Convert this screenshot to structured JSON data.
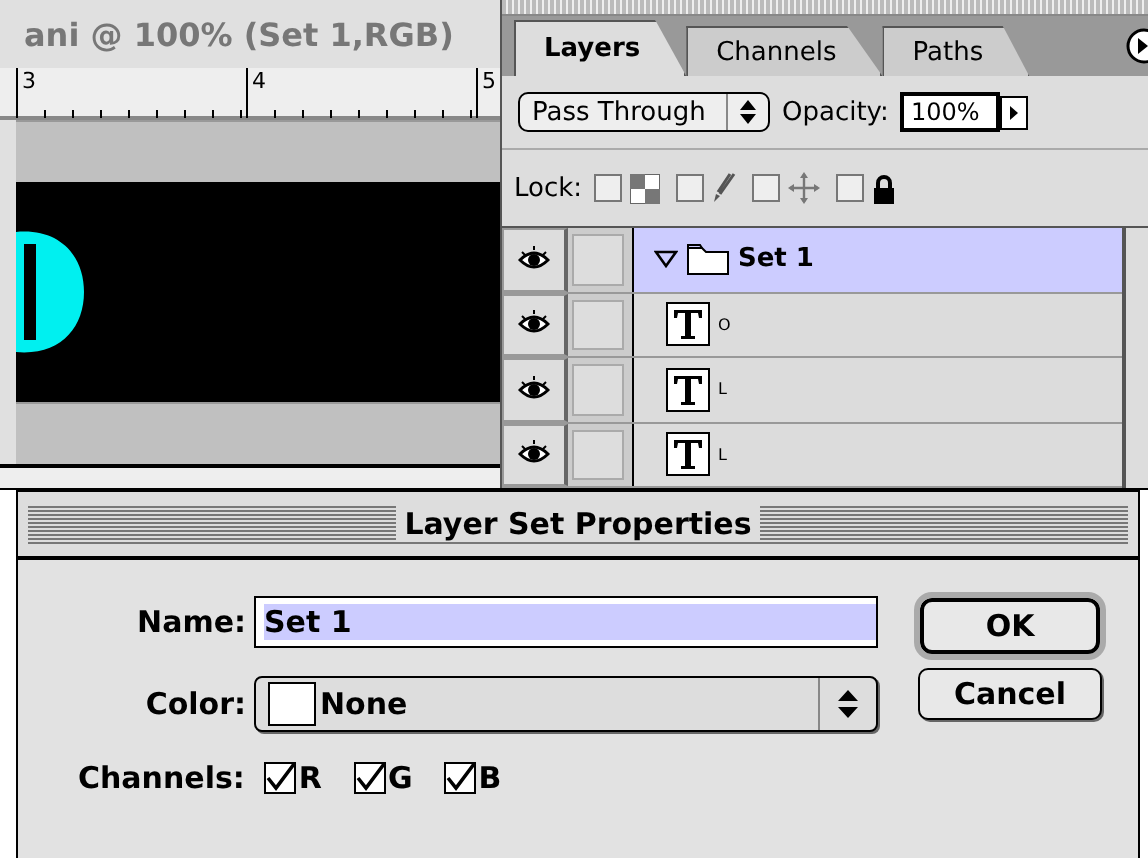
{
  "document": {
    "title": "ani @ 100% (Set 1,RGB)",
    "ruler_labels": [
      "3",
      "4",
      "5"
    ]
  },
  "layers_panel": {
    "tabs": [
      {
        "label": "Layers",
        "selected": true
      },
      {
        "label": "Channels",
        "selected": false
      },
      {
        "label": "Paths",
        "selected": false
      }
    ],
    "blend_mode": "Pass Through",
    "opacity_label": "Opacity:",
    "opacity": "100%",
    "lock_label": "Lock:",
    "locks": [
      {
        "kind": "transparency",
        "checked": false
      },
      {
        "kind": "paint",
        "checked": false
      },
      {
        "kind": "move",
        "checked": false
      },
      {
        "kind": "all",
        "checked": false
      }
    ],
    "layers": [
      {
        "kind": "set",
        "name": "Set 1",
        "visible": true,
        "expanded": true,
        "selected": true
      },
      {
        "kind": "text",
        "name": "O",
        "visible": true,
        "selected": false
      },
      {
        "kind": "text",
        "name": "L",
        "visible": true,
        "selected": false
      },
      {
        "kind": "text",
        "name": "L",
        "visible": true,
        "selected": false
      }
    ]
  },
  "dialog": {
    "title": "Layer Set Properties",
    "name_label": "Name:",
    "name_value": "Set 1",
    "color_label": "Color:",
    "color_value": "None",
    "channels_label": "Channels:",
    "channels": [
      {
        "label": "R",
        "checked": true
      },
      {
        "label": "G",
        "checked": true
      },
      {
        "label": "B",
        "checked": true
      }
    ],
    "buttons": [
      {
        "label": "OK",
        "default": true
      },
      {
        "label": "Cancel",
        "default": false
      }
    ]
  }
}
